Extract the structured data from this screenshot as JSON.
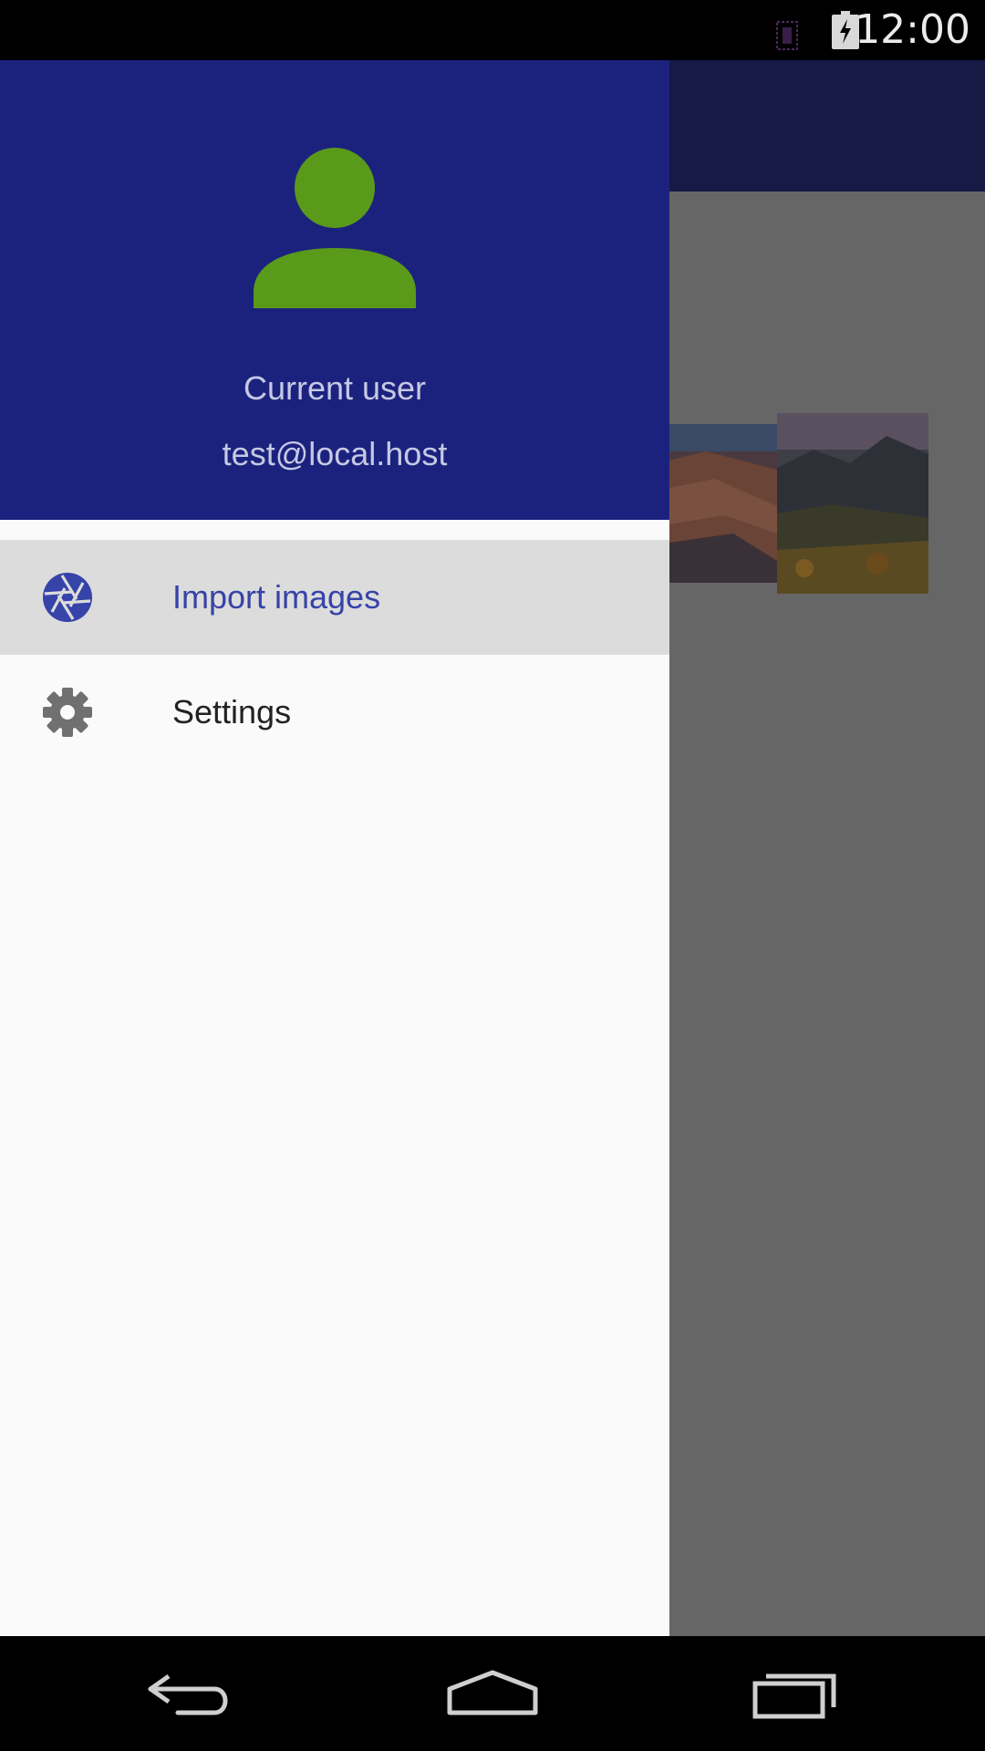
{
  "status_bar": {
    "time": "12:00",
    "icons": [
      "notification-icon",
      "battery-charging-icon"
    ]
  },
  "drawer": {
    "header": {
      "avatar_icon": "person-icon",
      "user_name": "Current user",
      "user_email": "test@local.host"
    },
    "items": [
      {
        "label": "Import images",
        "icon": "camera-aperture-icon",
        "selected": true
      },
      {
        "label": "Settings",
        "icon": "gear-icon",
        "selected": false
      }
    ]
  },
  "nav_bar": {
    "buttons": [
      "back-icon",
      "home-icon",
      "recents-icon"
    ]
  },
  "colors": {
    "drawer_header": "#1b227e",
    "avatar": "#5a9a1a",
    "accent": "#3643a8",
    "selected_bg": "#dcdcdc",
    "scrim": "#666666"
  }
}
